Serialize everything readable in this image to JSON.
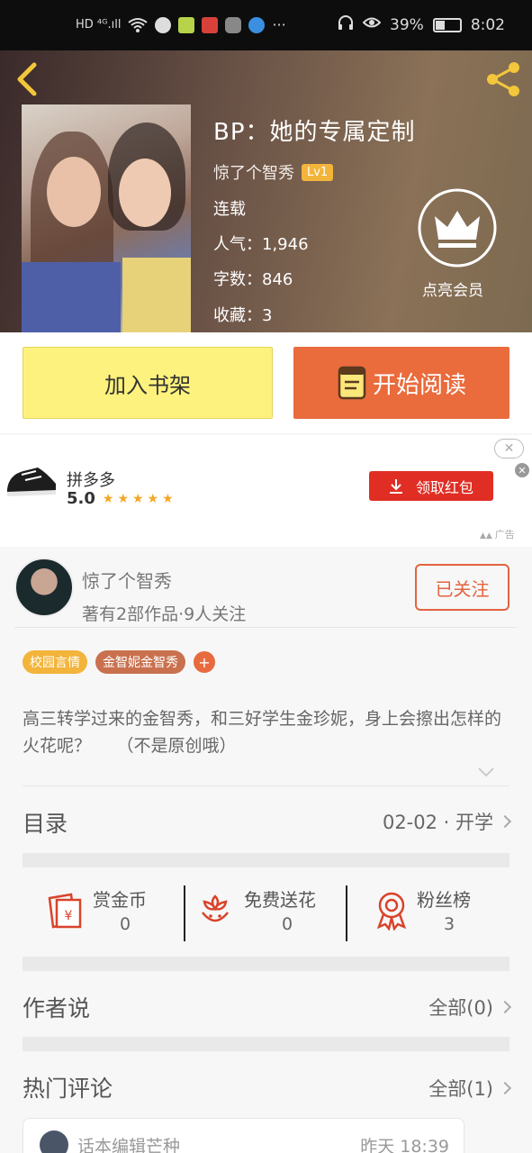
{
  "status_bar": {
    "left_text": "HD ⁴ᴳ.ıll",
    "battery": "39%",
    "time": "8:02"
  },
  "book": {
    "title": "BP：她的专属定制",
    "author": "惊了个智秀",
    "level": "Lv1",
    "status": "连载",
    "popularity": "人气：1,946",
    "word_count": "字数：846",
    "favorites": "收藏：3",
    "vip_label": "点亮会员"
  },
  "actions": {
    "add_shelf": "加入书架",
    "start_reading": "开始阅读"
  },
  "ad": {
    "name": "拼多多",
    "rating": "5.0",
    "stars": "★★★★★",
    "button": "领取红包",
    "tag": "广告",
    "close": "✕"
  },
  "author_card": {
    "name": "惊了个智秀",
    "info": "著有2部作品·9人关注",
    "follow": "已关注"
  },
  "tags": [
    {
      "label": "校园言情",
      "color": "#f3b43b"
    },
    {
      "label": "金智妮金智秀",
      "color": "#c9714f"
    }
  ],
  "tag_add": "+",
  "description": "高三转学过来的金智秀，和三好学生金珍妮，身上会擦出怎样的火花呢？　　（不是原创哦）",
  "toc": {
    "title": "目录",
    "latest": "02-02 · 开学"
  },
  "stats": [
    {
      "label": "赏金币",
      "value": "0"
    },
    {
      "label": "免费送花",
      "value": "0"
    },
    {
      "label": "粉丝榜",
      "value": "3"
    }
  ],
  "author_says": {
    "title": "作者说",
    "all": "全部(0)"
  },
  "hot_comments": {
    "title": "热门评论",
    "all": "全部(1)"
  },
  "comment": {
    "user": "话本编辑芒种",
    "time": "昨天 18:39"
  },
  "colors": {
    "accent": "#ea6b3c",
    "shelf_button": "#fdf27d",
    "ad_button": "#e02e24",
    "icon_red": "#d9432b"
  }
}
